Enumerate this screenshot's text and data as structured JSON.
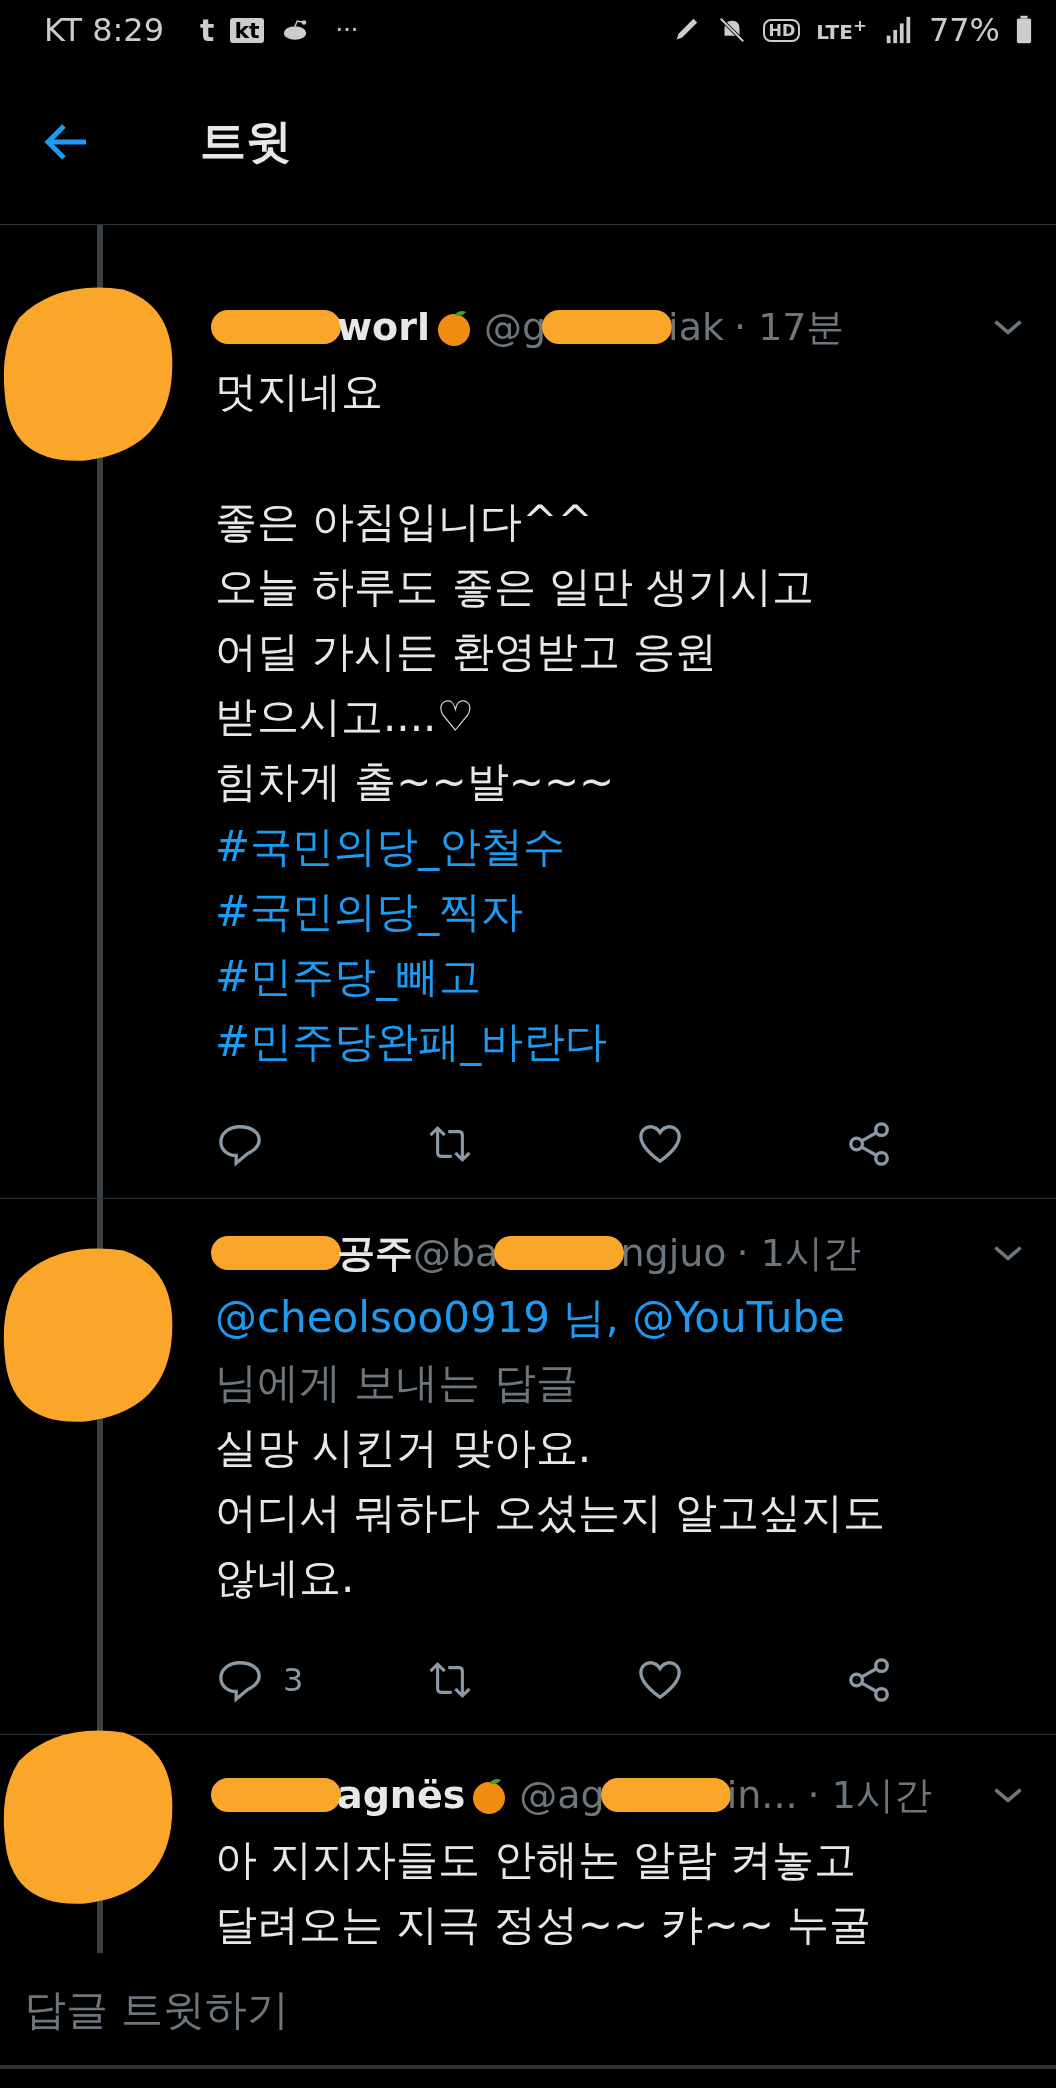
{
  "status_bar": {
    "carrier_time": "KT 8:29",
    "apps": [
      {
        "kind": "t",
        "text": "t"
      },
      {
        "kind": "kt",
        "text": "kt"
      },
      {
        "kind": "reddit"
      }
    ],
    "more": "···",
    "hd": "HD",
    "network": "LTE$^{+}$",
    "battery_text": "77%"
  },
  "header": {
    "title": "트윗"
  },
  "tweets": [
    {
      "header": [
        {
          "kind": "redacted"
        },
        {
          "kind": "name",
          "text": "worl"
        },
        {
          "kind": "emoji"
        },
        {
          "kind": "handle",
          "text": "@g"
        },
        {
          "kind": "redacted"
        },
        {
          "kind": "handle",
          "text": "iak"
        },
        {
          "kind": "time",
          "text": "· 17분"
        }
      ],
      "lines": [
        {
          "kind": "text",
          "text": "멋지네요"
        },
        {
          "kind": "blank"
        },
        {
          "kind": "text",
          "text": "좋은 아침입니다^^"
        },
        {
          "kind": "text",
          "text": "오늘 하루도 좋은 일만 생기시고"
        },
        {
          "kind": "text",
          "text": "어딜 가시든 환영받고 응원"
        },
        {
          "kind": "text",
          "text": "받으시고....♡"
        },
        {
          "kind": "text",
          "text": "힘차게 출~~발~~~"
        },
        {
          "kind": "hashtag",
          "text": "#국민의당_안철수"
        },
        {
          "kind": "hashtag",
          "text": "#국민의당_찍자"
        },
        {
          "kind": "hashtag",
          "text": "#민주당_빼고"
        },
        {
          "kind": "hashtag",
          "text": "#민주당완패_바란다"
        }
      ],
      "actions": true
    },
    {
      "header": [
        {
          "kind": "redacted"
        },
        {
          "kind": "name",
          "text": "공주"
        },
        {
          "kind": "handle",
          "text": "@ba"
        },
        {
          "kind": "redacted"
        },
        {
          "kind": "handle",
          "text": "ngjuo"
        },
        {
          "kind": "time",
          "text": "· 1시간"
        }
      ],
      "reply_to": "@cheolsoo0919 님, @YouTube",
      "reply_note": "님에게 보내는 답글",
      "lines": [
        {
          "kind": "text",
          "text": "실망 시킨거 맞아요."
        },
        {
          "kind": "text",
          "text": "어디서 뭐하다 오셨는지 알고싶지도"
        },
        {
          "kind": "text",
          "text": "않네요."
        }
      ],
      "reply_count": "3",
      "actions": true
    },
    {
      "header": [
        {
          "kind": "redacted"
        },
        {
          "kind": "name",
          "text": "agnës"
        },
        {
          "kind": "emoji"
        },
        {
          "kind": "handle",
          "text": "@ag"
        },
        {
          "kind": "redacted"
        },
        {
          "kind": "handle",
          "text": "in..."
        },
        {
          "kind": "time",
          "text": "· 1시간"
        }
      ],
      "lines": [
        {
          "kind": "text",
          "text": "아 지지자들도 안해논 알람 켜놓고"
        },
        {
          "kind": "text",
          "text": "달려오는 지극 정성~~ 캬~~ 누굴"
        }
      ],
      "actions": false
    }
  ],
  "reply_bar": {
    "placeholder": "답글 트윗하기"
  }
}
